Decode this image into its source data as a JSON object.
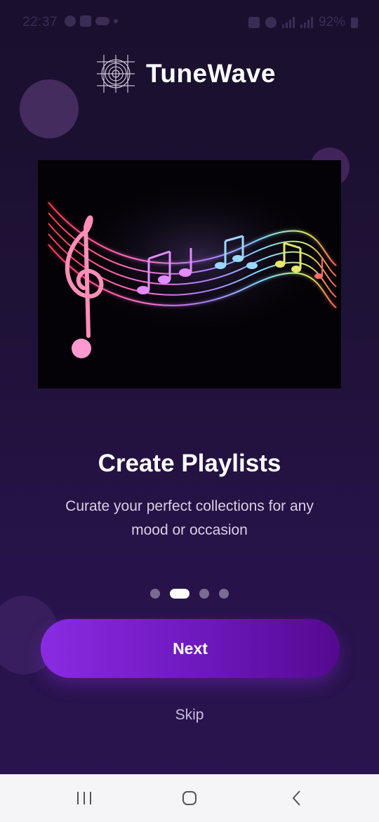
{
  "status_bar": {
    "time": "22:37",
    "battery": "92%"
  },
  "brand": {
    "name": "TuneWave",
    "logo_icon": "tunewave-logo-icon"
  },
  "hero_image": {
    "icon": "music-notes-staff-icon"
  },
  "onboarding": {
    "title": "Create Playlists",
    "subtitle": "Curate your perfect collections for any mood or occasion",
    "page_index": 2,
    "page_count": 4
  },
  "actions": {
    "next_label": "Next",
    "skip_label": "Skip"
  },
  "colors": {
    "background": "#1f1238",
    "accent": "#8a2be2",
    "accent_dark": "#55098f",
    "text_primary": "#ffffff",
    "text_secondary": "#d8cfe6"
  },
  "system_nav": {
    "recents_icon": "recents-icon",
    "home_icon": "home-icon",
    "back_icon": "back-icon"
  }
}
